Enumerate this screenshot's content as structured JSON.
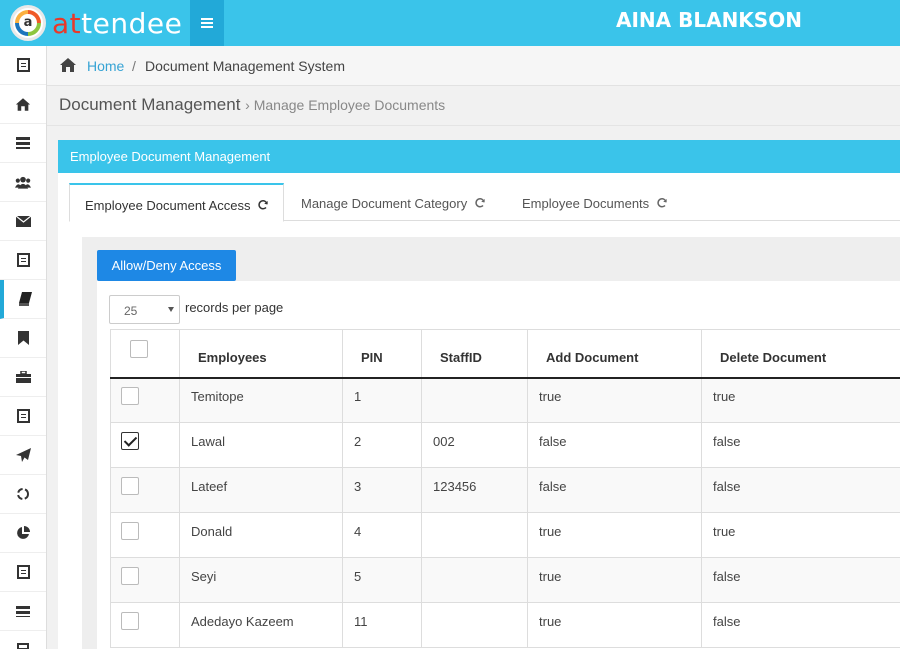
{
  "app": {
    "logo_letter": "a",
    "logo_text_accent": "at",
    "logo_text_rest": "tendee",
    "user_name": "AINA BLANKSON"
  },
  "sidebar": {
    "items": [
      {
        "icon": "document-list-icon"
      },
      {
        "icon": "home-icon"
      },
      {
        "icon": "server-icon"
      },
      {
        "icon": "users-icon"
      },
      {
        "icon": "envelope-icon"
      },
      {
        "icon": "list-alt-icon"
      },
      {
        "icon": "book-icon",
        "active": true
      },
      {
        "icon": "bookmark-icon"
      },
      {
        "icon": "briefcase-icon"
      },
      {
        "icon": "list-alt-icon"
      },
      {
        "icon": "paper-plane-icon"
      },
      {
        "icon": "recycle-icon"
      },
      {
        "icon": "pie-chart-icon"
      },
      {
        "icon": "list-alt-icon"
      },
      {
        "icon": "bars-icon"
      },
      {
        "icon": "calculator-icon"
      }
    ]
  },
  "breadcrumb": {
    "home": "Home",
    "separator": "/",
    "current": "Document Management System"
  },
  "heading": {
    "title": "Document Management",
    "subtitle": "› Manage Employee Documents"
  },
  "panel": {
    "title": "Employee Document Management",
    "tabs": [
      {
        "label": "Employee Document Access",
        "active": true
      },
      {
        "label": "Manage Document Category"
      },
      {
        "label": "Employee Documents"
      }
    ]
  },
  "access_button": "Allow/Deny Access",
  "pagination": {
    "per_page_value": "25",
    "per_page_label": "records per page"
  },
  "table": {
    "columns": [
      "Employees",
      "PIN",
      "StaffID",
      "Add Document",
      "Delete Document"
    ],
    "rows": [
      {
        "checked": false,
        "employee": "Temitope",
        "pin": "1",
        "staff_id": "",
        "add": "true",
        "delete": "true"
      },
      {
        "checked": true,
        "employee": "Lawal",
        "pin": "2",
        "staff_id": "002",
        "add": "false",
        "delete": "false"
      },
      {
        "checked": false,
        "employee": "Lateef",
        "pin": "3",
        "staff_id": "123456",
        "add": "false",
        "delete": "false"
      },
      {
        "checked": false,
        "employee": "Donald",
        "pin": "4",
        "staff_id": "",
        "add": "true",
        "delete": "true"
      },
      {
        "checked": false,
        "employee": "Seyi",
        "pin": "5",
        "staff_id": "",
        "add": "true",
        "delete": "false"
      },
      {
        "checked": false,
        "employee": "Adedayo Kazeem",
        "pin": "11",
        "staff_id": "",
        "add": "true",
        "delete": "false"
      }
    ]
  },
  "colors": {
    "topbar": "#3ac4ea",
    "accent": "#22a9d8",
    "button": "#1e88e5",
    "link": "#36a3d4"
  }
}
